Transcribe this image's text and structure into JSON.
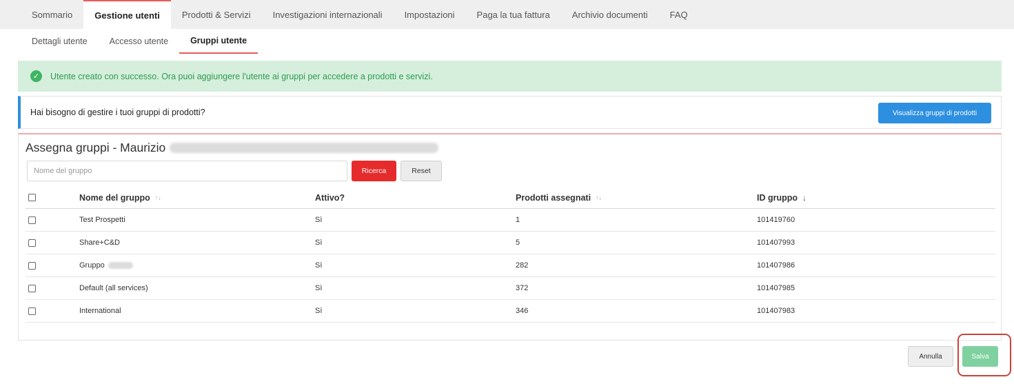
{
  "topnav": {
    "tabs": [
      {
        "label": "Sommario"
      },
      {
        "label": "Gestione utenti"
      },
      {
        "label": "Prodotti & Servizi"
      },
      {
        "label": "Investigazioni internazionali"
      },
      {
        "label": "Impostazioni"
      },
      {
        "label": "Paga la tua fattura"
      },
      {
        "label": "Archivio documenti"
      },
      {
        "label": "FAQ"
      }
    ],
    "active_tab": "Gestione utenti"
  },
  "subnav": {
    "tabs": [
      {
        "label": "Dettagli utente"
      },
      {
        "label": "Accesso utente"
      },
      {
        "label": "Gruppi utente"
      }
    ],
    "active_tab": "Gruppi utente"
  },
  "success_alert": {
    "icon": "check-circle-icon",
    "message": "Utente creato con successo. Ora puoi aggiungere l'utente ai gruppi per accedere a prodotti e servizi."
  },
  "info_bar": {
    "text": "Hai bisogno di gestire i tuoi gruppi di prodotti?",
    "button_label": "Visualizza gruppi di prodotti"
  },
  "assign_panel": {
    "title": "Assegna gruppi - Maurizio",
    "search": {
      "placeholder": "Nome del gruppo",
      "value": ""
    },
    "search_button": "Ricerca",
    "reset_button": "Reset",
    "columns": {
      "name": "Nome del gruppo",
      "active": "Attivo?",
      "products": "Prodotti assegnati",
      "id": "ID gruppo"
    },
    "rows": [
      {
        "name": "Test Prospetti",
        "active": "Sì",
        "products": "1",
        "id": "101419760",
        "checked": false
      },
      {
        "name": "Share+C&D",
        "active": "Sì",
        "products": "5",
        "id": "101407993",
        "checked": false
      },
      {
        "name": "Gruppo",
        "active": "Sì",
        "products": "282",
        "id": "101407986",
        "checked": false
      },
      {
        "name": "Default (all services)",
        "active": "Sì",
        "products": "372",
        "id": "101407985",
        "checked": false
      },
      {
        "name": "International",
        "active": "Sì",
        "products": "346",
        "id": "101407983",
        "checked": false
      }
    ]
  },
  "footer": {
    "cancel_button": "Annulla",
    "save_button": "Salva"
  },
  "colors": {
    "accent_red": "#e52b2b",
    "tab_underline": "#e85a5a",
    "info_blue": "#2d8fe0",
    "success_green": "#3fb463",
    "save_green": "#7fd1a0"
  }
}
